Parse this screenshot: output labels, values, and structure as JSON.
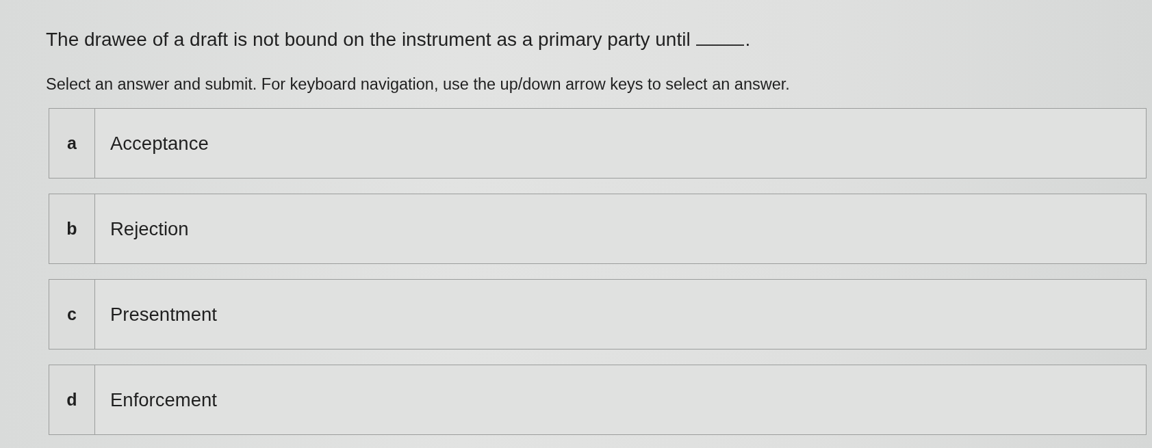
{
  "question": {
    "text": "The drawee of a draft is not bound on the instrument as a primary party until",
    "blank": true,
    "text_after": "."
  },
  "instructions": "Select an answer and submit. For keyboard navigation, use the up/down arrow keys to select an answer.",
  "options": [
    {
      "letter": "a",
      "label": "Acceptance",
      "selected": false
    },
    {
      "letter": "b",
      "label": "Rejection",
      "selected": false
    },
    {
      "letter": "c",
      "label": "Presentment",
      "selected": false
    },
    {
      "letter": "d",
      "label": "Enforcement",
      "selected": false
    }
  ]
}
